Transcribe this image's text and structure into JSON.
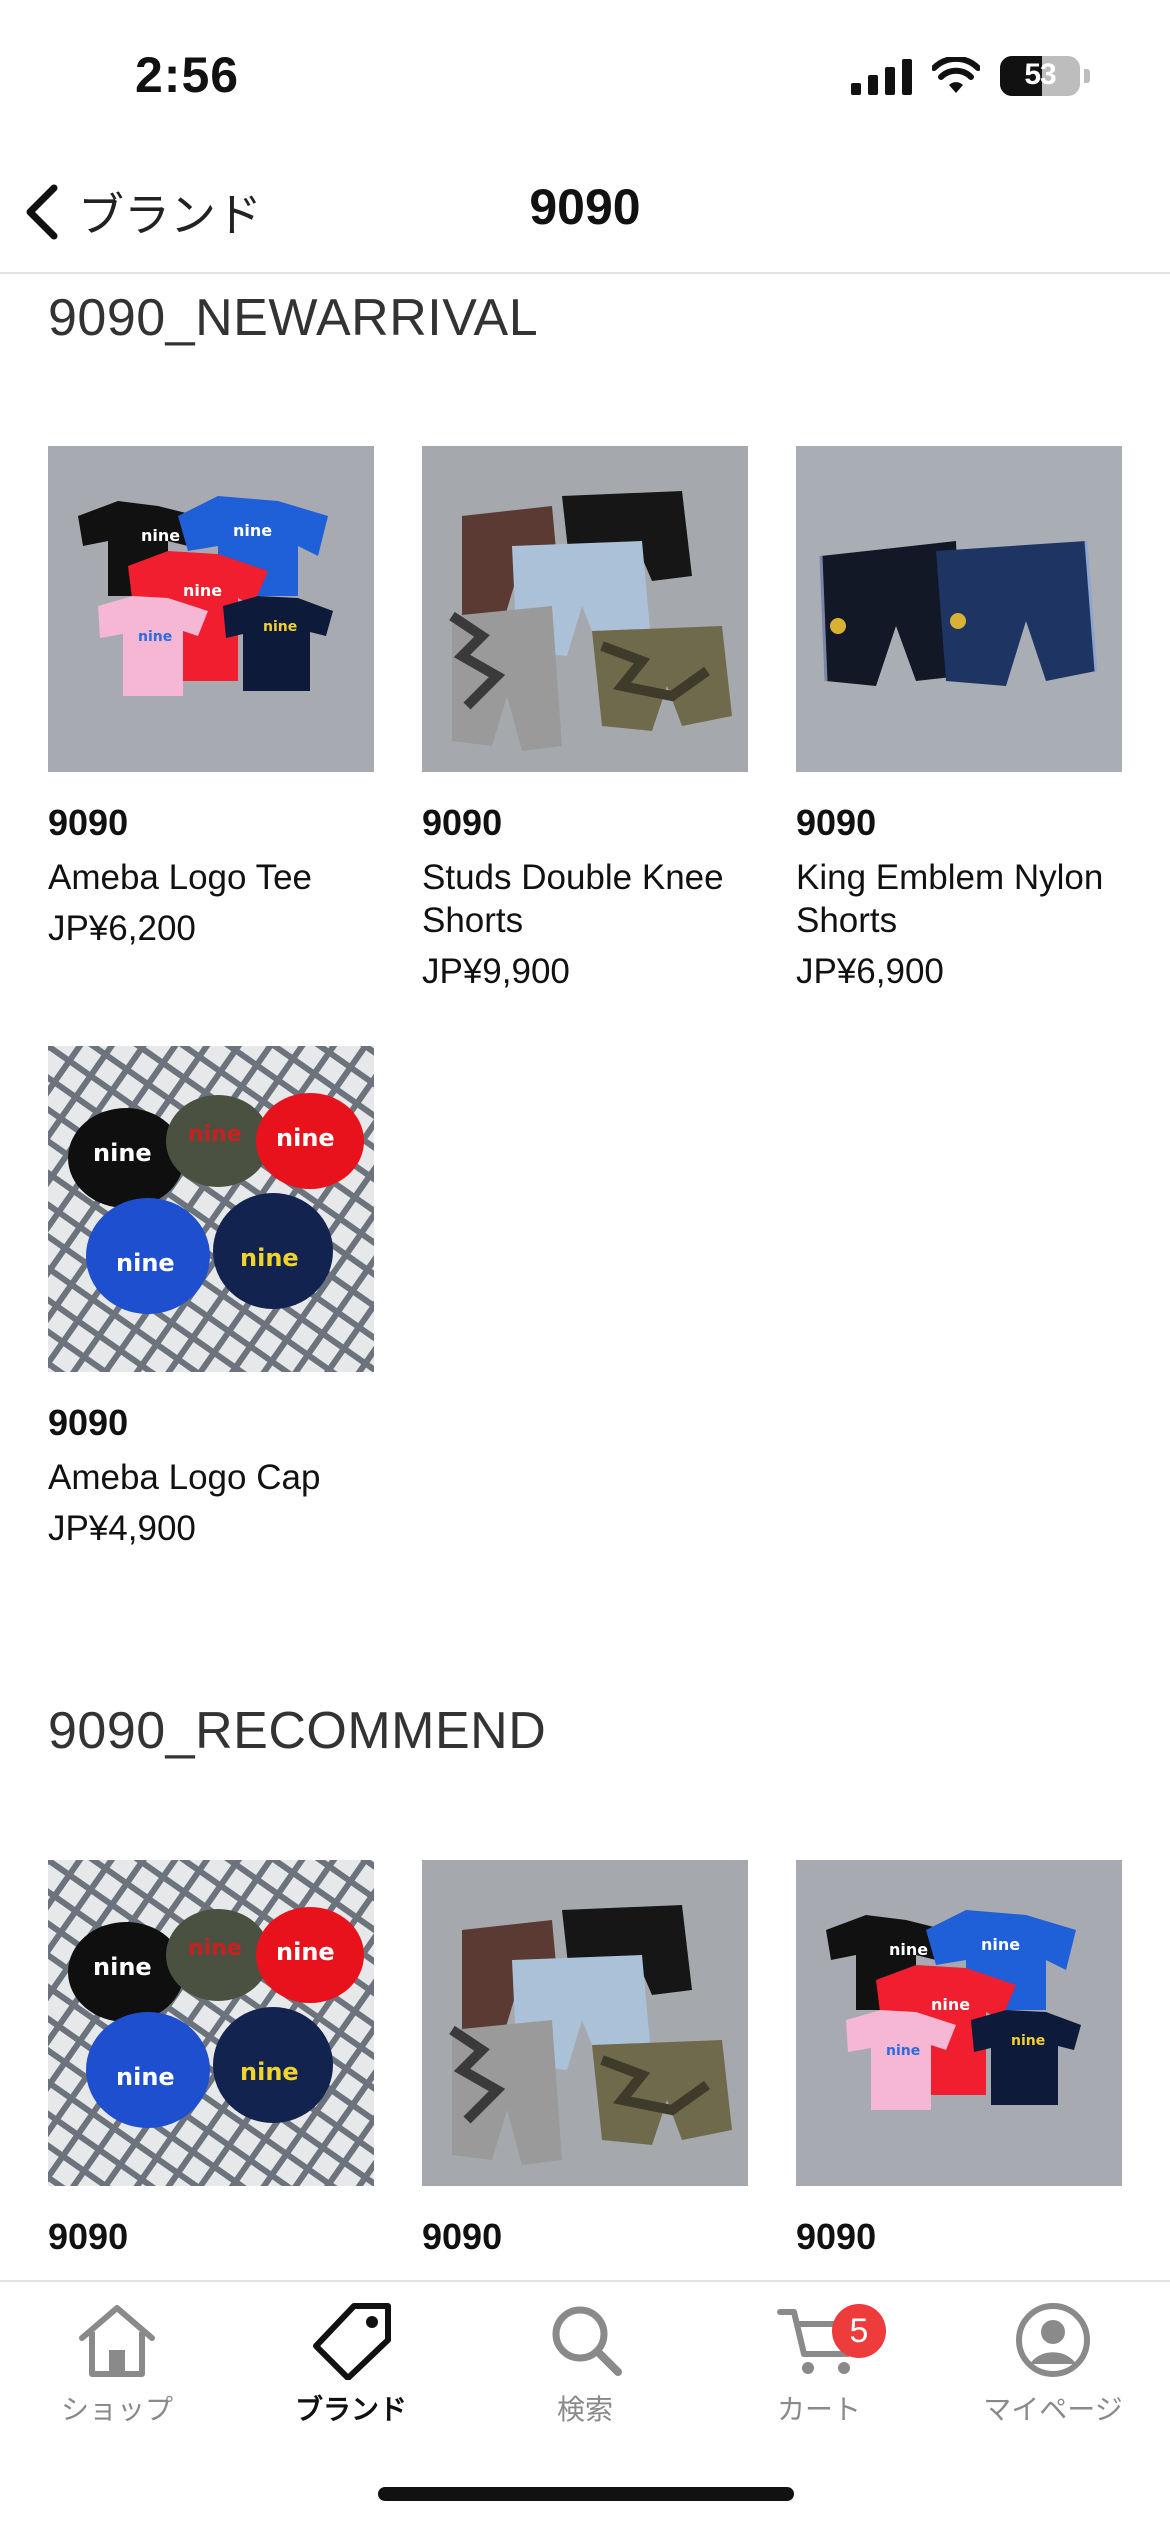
{
  "status_bar": {
    "time": "2:56",
    "battery": "53",
    "battery_level_percent": 53
  },
  "nav": {
    "back_label": "ブランド",
    "title": "9090"
  },
  "sections": [
    {
      "title": "9090_NEWARRIVAL",
      "products": [
        {
          "brand": "9090",
          "name": "Ameba Logo Tee",
          "price": "JP¥6,200",
          "image": "tees"
        },
        {
          "brand": "9090",
          "name": "Studs Double Knee Shorts",
          "price": "JP¥9,900",
          "image": "shorts"
        },
        {
          "brand": "9090",
          "name": "King Emblem Nylon Shorts",
          "price": "JP¥6,900",
          "image": "nylon-shorts"
        },
        {
          "brand": "9090",
          "name": "Ameba Logo Cap",
          "price": "JP¥4,900",
          "image": "caps"
        }
      ]
    },
    {
      "title": "9090_RECOMMEND",
      "products": [
        {
          "brand": "9090",
          "name": "",
          "price": "",
          "image": "caps"
        },
        {
          "brand": "9090",
          "name": "",
          "price": "",
          "image": "shorts"
        },
        {
          "brand": "9090",
          "name": "",
          "price": "",
          "image": "tees"
        }
      ]
    }
  ],
  "tab_bar": {
    "tabs": [
      {
        "label": "ショップ",
        "icon": "home-icon"
      },
      {
        "label": "ブランド",
        "icon": "tag-icon"
      },
      {
        "label": "検索",
        "icon": "search-icon"
      },
      {
        "label": "カート",
        "icon": "cart-icon",
        "badge": "5"
      },
      {
        "label": "マイページ",
        "icon": "profile-icon"
      }
    ],
    "active": "ブランド"
  },
  "colors": {
    "accent_badge": "#ee3b3b",
    "divider": "#e2e2e2",
    "inactive_tab": "#8a8a8a"
  }
}
